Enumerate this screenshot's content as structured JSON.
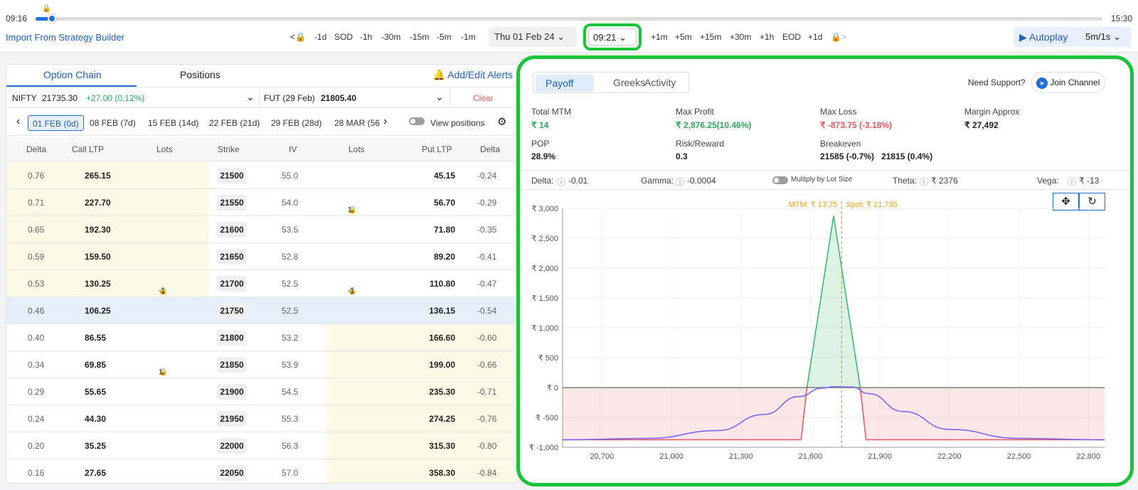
{
  "timeline": {
    "start": "09:16",
    "end": "15:30"
  },
  "toolbar": {
    "import_label": "Import From Strategy Builder",
    "back_steps": [
      "-1d",
      "SOD",
      "-1h",
      "-30m",
      "-15m",
      "-5m",
      "-1m"
    ],
    "date": "Thu  01 Feb 24",
    "time": "09:21",
    "forward_steps": [
      "+1m",
      "+5m",
      "+15m",
      "+30m",
      "+1h",
      "EOD",
      "+1d"
    ],
    "autoplay_label": "Autoplay",
    "speed": "5m/1s"
  },
  "left": {
    "tabs": [
      "Option Chain",
      "Positions"
    ],
    "alerts_label": "Add/Edit Alerts",
    "spot_name": "NIFTY",
    "spot_price": "21735.30",
    "spot_change": "+27.00 (0.12%)",
    "fut_name": "FUT (29 Feb)",
    "fut_price": "21805.40",
    "clear_label": "Clear",
    "expiries": [
      "01 FEB (0d)",
      "08 FEB (7d)",
      "15 FEB (14d)",
      "22 FEB (21d)",
      "29 FEB (28d)",
      "28 MAR (56"
    ],
    "view_positions_label": "View positions",
    "headers": [
      "Delta",
      "Call LTP",
      "Lots",
      "Strike",
      "IV",
      "Lots",
      "Put LTP",
      "Delta"
    ],
    "rows": [
      {
        "cd": "0.76",
        "cltp": "265.15",
        "clots": "",
        "strike": "21500",
        "iv": "55.0",
        "plots": "",
        "pltp": "45.15",
        "pd": "-0.24"
      },
      {
        "cd": "0.71",
        "cltp": "227.70",
        "clots": "",
        "strike": "21550",
        "iv": "54.0",
        "plots": "1",
        "pltp": "56.70",
        "pd": "-0.29"
      },
      {
        "cd": "0.65",
        "cltp": "192.30",
        "clots": "",
        "strike": "21600",
        "iv": "53.5",
        "plots": "",
        "pltp": "71.80",
        "pd": "-0.35"
      },
      {
        "cd": "0.59",
        "cltp": "159.50",
        "clots": "",
        "strike": "21650",
        "iv": "52.8",
        "plots": "",
        "pltp": "89.20",
        "pd": "-0.41"
      },
      {
        "cd": "0.53",
        "cltp": "130.25",
        "clots": "-1",
        "strike": "21700",
        "iv": "52.5",
        "plots": "-1",
        "pltp": "110.80",
        "pd": "-0.47"
      },
      {
        "cd": "0.46",
        "cltp": "106.25",
        "clots": "",
        "strike": "21750",
        "iv": "52.5",
        "plots": "",
        "pltp": "136.15",
        "pd": "-0.54"
      },
      {
        "cd": "0.40",
        "cltp": "86.55",
        "clots": "",
        "strike": "21800",
        "iv": "53.2",
        "plots": "",
        "pltp": "166.60",
        "pd": "-0.60"
      },
      {
        "cd": "0.34",
        "cltp": "69.85",
        "clots": "1",
        "strike": "21850",
        "iv": "53.9",
        "plots": "",
        "pltp": "199.00",
        "pd": "-0.66"
      },
      {
        "cd": "0.29",
        "cltp": "55.65",
        "clots": "",
        "strike": "21900",
        "iv": "54.5",
        "plots": "",
        "pltp": "235.30",
        "pd": "-0.71"
      },
      {
        "cd": "0.24",
        "cltp": "44.30",
        "clots": "",
        "strike": "21950",
        "iv": "55.3",
        "plots": "",
        "pltp": "274.25",
        "pd": "-0.76"
      },
      {
        "cd": "0.20",
        "cltp": "35.25",
        "clots": "",
        "strike": "22000",
        "iv": "56.3",
        "plots": "",
        "pltp": "315.30",
        "pd": "-0.80"
      },
      {
        "cd": "0.16",
        "cltp": "27.65",
        "clots": "",
        "strike": "22050",
        "iv": "57.0",
        "plots": "",
        "pltp": "358.30",
        "pd": "-0.84"
      }
    ]
  },
  "right": {
    "tabs": [
      "Payoff",
      "Greeks",
      "Activity"
    ],
    "support_label": "Need Support?",
    "join_label": "Join Channel",
    "stats": {
      "total_mtm_label": "Total MTM",
      "total_mtm": "₹ 14",
      "max_profit_label": "Max Profit",
      "max_profit": "₹ 2,876.25(10.46%)",
      "max_loss_label": "Max Loss",
      "max_loss": "₹ -873.75 (-3.18%)",
      "margin_label": "Margin Approx",
      "margin": "₹ 27,492",
      "pop_label": "POP",
      "pop": "28.9%",
      "rr_label": "Risk/Reward",
      "rr": "0.3",
      "breakeven_label": "Breakeven",
      "breakeven": "21585 (-0.7%)   21815 (0.4%)"
    },
    "greeks": {
      "delta_label": "Delta:",
      "delta": "-0.01",
      "gamma_label": "Gamma:",
      "gamma": "-0.0004",
      "multiply_label": "Mulitply by Lot Size",
      "theta_label": "Theta:",
      "theta": "₹ 2376",
      "vega_label": "Vega:",
      "vega": "₹ -13"
    }
  },
  "chart_data": {
    "type": "area",
    "y_ticks": [
      "₹ 3,000",
      "₹ 2,500",
      "₹ 2,000",
      "₹ 1,500",
      "₹ 1,000",
      "₹ 500",
      "₹ 0",
      "₹ -500",
      "₹ -1,000"
    ],
    "x_ticks": [
      "20,700",
      "21,000",
      "21,300",
      "21,600",
      "21,900",
      "22,200",
      "22,500",
      "22,800"
    ],
    "xlim": [
      20530,
      22870
    ],
    "ylim": [
      -1000,
      3000
    ],
    "mtm_label": "MTM: ₹ 13.75",
    "spot_label": "Spot: ₹ 21,735",
    "spot_x": 21735,
    "expiry_payoff": {
      "x": [
        20530,
        21560,
        21585,
        21700,
        21815,
        21840,
        22870
      ],
      "y": [
        -874,
        -874,
        0,
        2876,
        0,
        -874,
        -874
      ]
    },
    "target_payoff": {
      "x": [
        20530,
        20900,
        21200,
        21400,
        21550,
        21650,
        21700,
        21780,
        21850,
        22000,
        22200,
        22500,
        22870
      ],
      "y": [
        -874,
        -850,
        -720,
        -450,
        -150,
        -10,
        14,
        10,
        -100,
        -400,
        -700,
        -850,
        -874
      ]
    },
    "colors": {
      "profit": "#35b86b",
      "loss": "#e8555e",
      "target": "#7b68ee",
      "spot": "#e0a020",
      "zero": "#666666"
    }
  }
}
